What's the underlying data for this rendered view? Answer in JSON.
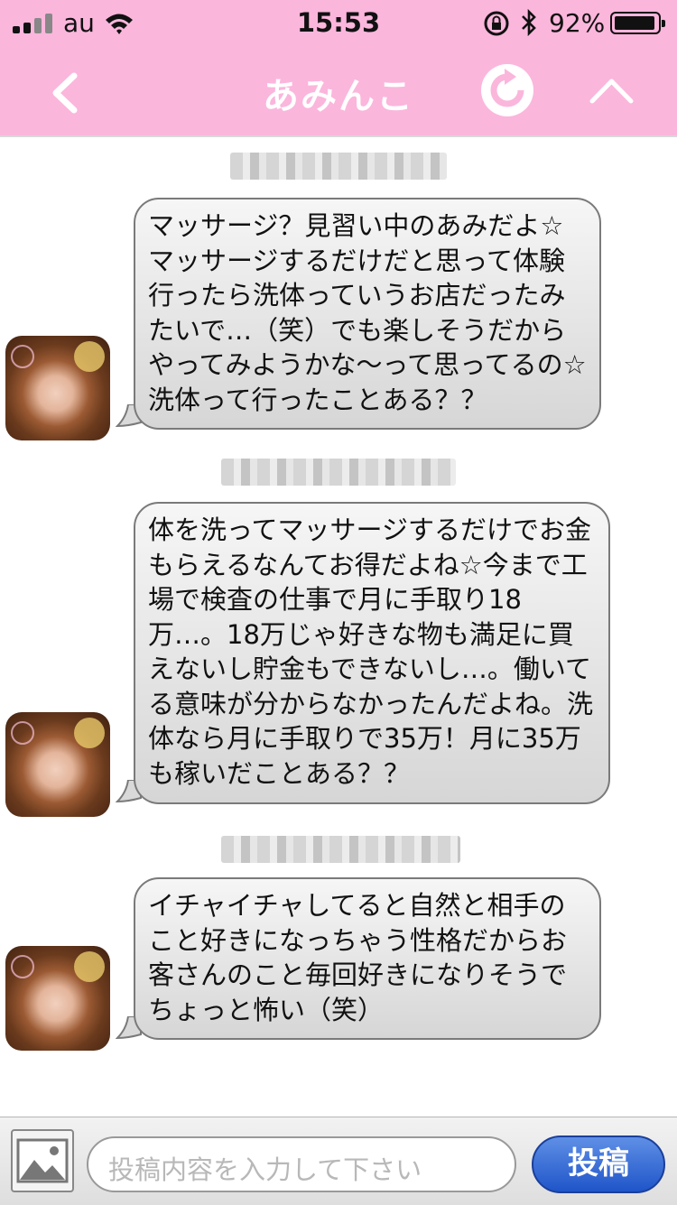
{
  "status_bar": {
    "carrier": "au",
    "time": "15:53",
    "battery_percent": "92%",
    "battery_level": 0.92
  },
  "header": {
    "title": "あみんこ",
    "back_icon": "chevron-left-icon",
    "refresh_icon": "refresh-icon",
    "collapse_icon": "chevron-up-icon"
  },
  "messages": [
    {
      "timestamp": "",
      "text": "マッサージ？見習い中のあみだよ☆マッサージするだけだと思って体験行ったら洗体っていうお店だったみたいで…（笑）でも楽しそうだからやってみようかな〜って思ってるの☆洗体って行ったことある？？"
    },
    {
      "timestamp": "",
      "text": "体を洗ってマッサージするだけでお金もらえるなんてお得だよね☆今まで工場で検査の仕事で月に手取り18万…。18万じゃ好きな物も満足に買えないし貯金もできないし…。働いてる意味が分からなかったんだよね。洗体なら月に手取りで35万！月に35万も稼いだことある？？"
    },
    {
      "timestamp": "",
      "text": "イチャイチャしてると自然と相手のこと好きになっちゃう性格だからお客さんのこと毎回好きになりそうでちょっと怖い（笑）"
    }
  ],
  "composer": {
    "placeholder": "投稿内容を入力して下さい",
    "send_label": "投稿",
    "image_icon": "image-icon"
  },
  "colors": {
    "header_pink": "#fbb6dc",
    "send_blue": "#2a5fd1",
    "bubble_gray": "#e2e2e2"
  }
}
